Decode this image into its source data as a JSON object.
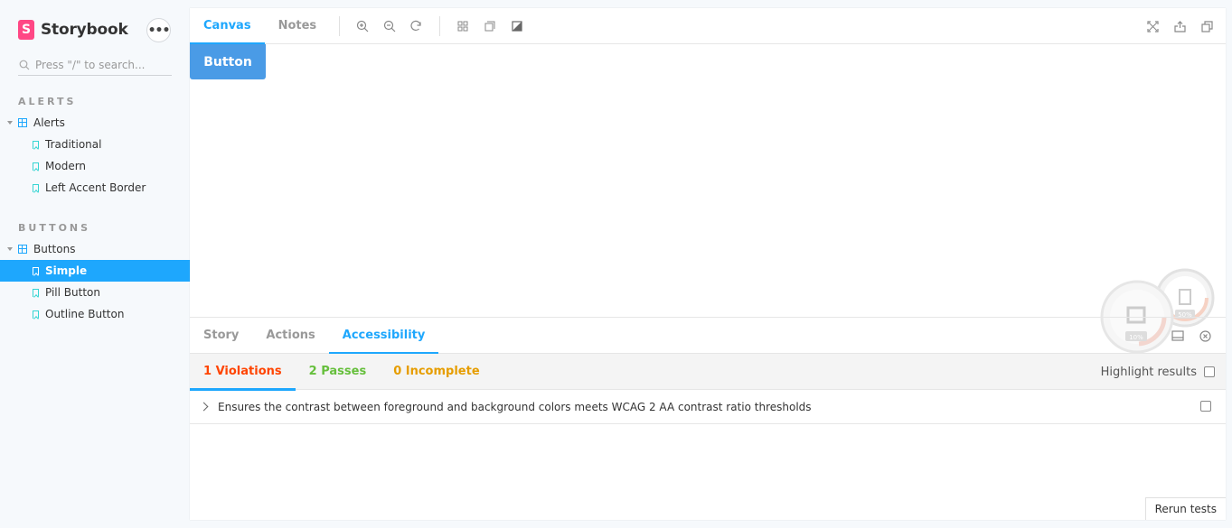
{
  "sidebar": {
    "brand": {
      "logo": "S",
      "name": "Storybook"
    },
    "menu_label": "•••",
    "search": {
      "placeholder": "Press \"/\" to search..."
    },
    "sections": [
      {
        "title": "ALERTS",
        "group": "Alerts",
        "stories": [
          "Traditional",
          "Modern",
          "Left Accent Border"
        ]
      },
      {
        "title": "BUTTONS",
        "group": "Buttons",
        "stories": [
          "Simple",
          "Pill Button",
          "Outline Button"
        ]
      }
    ],
    "active_story": "Simple"
  },
  "toolbar": {
    "tabs": [
      "Canvas",
      "Notes"
    ],
    "active_tab": "Canvas",
    "icons": [
      "zoom-in-icon",
      "zoom-out-icon",
      "zoom-reset-icon",
      "grid-icon",
      "background-icon",
      "contrast-icon"
    ],
    "right_icons": [
      "fullscreen-icon",
      "share-icon",
      "copy-icon"
    ]
  },
  "preview": {
    "button_label": "Button"
  },
  "addons": {
    "tabs": [
      "Story",
      "Actions",
      "Accessibility"
    ],
    "active_tab": "Accessibility",
    "a11y": {
      "violations": "1 Violations",
      "passes": "2 Passes",
      "incomplete": "0 Incomplete",
      "highlight_label": "Highlight results",
      "rules": [
        "Ensures the contrast between foreground and background colors meets WCAG 2 AA contrast ratio thresholds"
      ],
      "rerun_label": "Rerun tests"
    },
    "gauges": [
      "10%",
      "50%"
    ]
  },
  "colors": {
    "accent": "#1ea7fd",
    "brand": "#ff4785",
    "violation": "#ff4400",
    "pass": "#66bf3c",
    "incomplete": "#e69d00"
  }
}
